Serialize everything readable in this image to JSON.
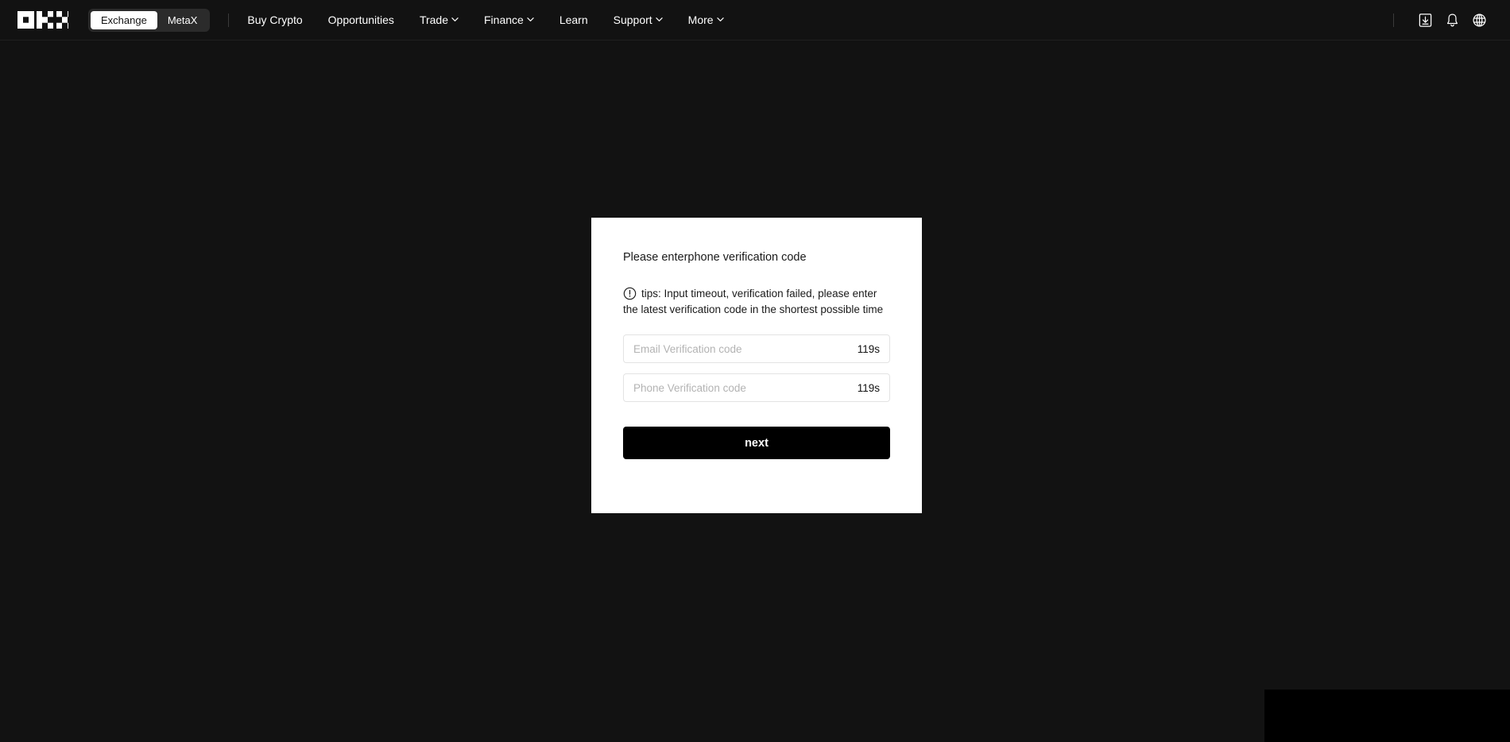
{
  "header": {
    "logo_name": "okx-logo",
    "segmented": {
      "items": [
        {
          "label": "Exchange",
          "active": true
        },
        {
          "label": "MetaX",
          "active": false
        }
      ]
    },
    "nav": [
      {
        "label": "Buy Crypto",
        "caret": false
      },
      {
        "label": "Opportunities",
        "caret": false
      },
      {
        "label": "Trade",
        "caret": true
      },
      {
        "label": "Finance",
        "caret": true
      },
      {
        "label": "Learn",
        "caret": false
      },
      {
        "label": "Support",
        "caret": true
      },
      {
        "label": "More",
        "caret": true
      }
    ],
    "actions": [
      {
        "icon": "download-icon"
      },
      {
        "icon": "bell-icon"
      },
      {
        "icon": "globe-icon"
      }
    ]
  },
  "card": {
    "title": "Please enterphone verification code",
    "tips_icon": "exclamation-circle-icon",
    "tips": "tips: Input timeout, verification failed, please enter the latest verification code in the shortest possible time",
    "fields": [
      {
        "name": "email-verification-code",
        "placeholder": "Email Verification code",
        "value": "",
        "timer": "119s"
      },
      {
        "name": "phone-verification-code",
        "placeholder": "Phone Verification code",
        "value": "",
        "timer": "119s"
      }
    ],
    "submit_label": "next"
  },
  "colors": {
    "background": "#121212",
    "card_bg": "#ffffff",
    "accent": "#000000",
    "border": "#e3e3e3",
    "placeholder": "#b3b3b3"
  }
}
